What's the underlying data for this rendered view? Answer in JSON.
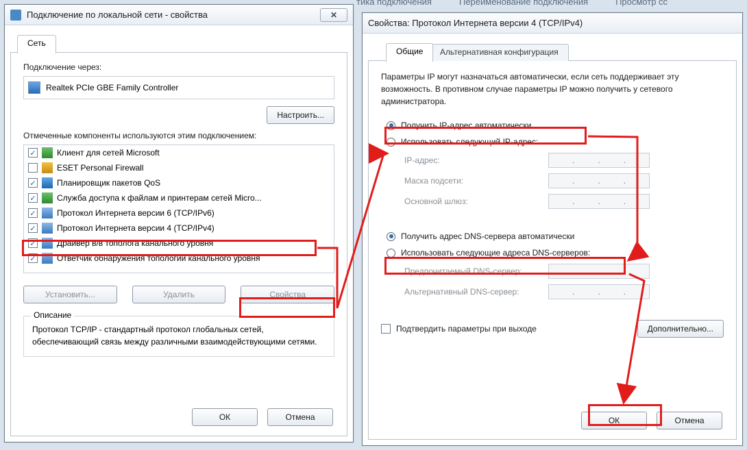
{
  "topbar": {
    "item1": "тика подключения",
    "item2": "Переименование подключения",
    "item3": "Просмотр сс"
  },
  "left": {
    "title": "Подключение по локальной сети - свойства",
    "tab": "Сеть",
    "connect_via": "Подключение через:",
    "adapter": "Realtek PCIe GBE Family Controller",
    "configure_btn": "Настроить...",
    "components_label": "Отмеченные компоненты используются этим подключением:",
    "items": [
      {
        "checked": true,
        "icon": "ic-net",
        "label": "Клиент для сетей Microsoft"
      },
      {
        "checked": false,
        "icon": "ic-fire",
        "label": "ESET Personal Firewall"
      },
      {
        "checked": true,
        "icon": "ic-qos",
        "label": "Планировщик пакетов QoS"
      },
      {
        "checked": true,
        "icon": "ic-net",
        "label": "Служба доступа к файлам и принтерам сетей Micro..."
      },
      {
        "checked": true,
        "icon": "ic-proto",
        "label": "Протокол Интернета версии 6 (TCP/IPv6)"
      },
      {
        "checked": true,
        "icon": "ic-proto",
        "label": "Протокол Интернета версии 4 (TCP/IPv4)"
      },
      {
        "checked": true,
        "icon": "ic-proto",
        "label": "Драйвер в/в тополога канального уровня"
      },
      {
        "checked": true,
        "icon": "ic-proto",
        "label": "Ответчик обнаружения топологии канального уровня"
      }
    ],
    "install_btn": "Установить...",
    "remove_btn": "Удалить",
    "props_btn": "Свойства",
    "desc_legend": "Описание",
    "desc_text": "Протокол TCP/IP - стандартный протокол глобальных сетей, обеспечивающий связь между различными взаимодействующими сетями.",
    "ok": "ОК",
    "cancel": "Отмена"
  },
  "right": {
    "title": "Свойства: Протокол Интернета версии 4 (TCP/IPv4)",
    "tab_general": "Общие",
    "tab_alt": "Альтернативная конфигурация",
    "intro": "Параметры IP могут назначаться автоматически, если сеть поддерживает эту возможность. В противном случае параметры IP можно получить у сетевого администратора.",
    "ip_auto": "Получить IP-адрес автоматически",
    "ip_manual": "Использовать следующий IP-адрес:",
    "ip_addr": "IP-адрес:",
    "mask": "Маска подсети:",
    "gateway": "Основной шлюз:",
    "dns_auto": "Получить адрес DNS-сервера автоматически",
    "dns_manual": "Использовать следующие адреса DNS-серверов:",
    "dns_pref": "Предпочитаемый DNS-сервер:",
    "dns_alt": "Альтернативный DNS-сервер:",
    "validate": "Подтвердить параметры при выходе",
    "advanced": "Дополнительно...",
    "ok": "ОК",
    "cancel": "Отмена"
  }
}
